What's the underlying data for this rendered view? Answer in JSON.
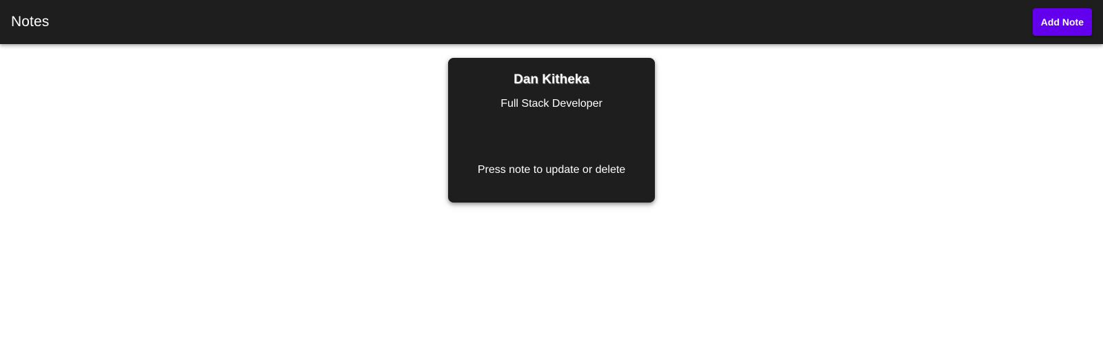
{
  "app_bar": {
    "title": "Notes",
    "add_button_label": "Add Note"
  },
  "notes": [
    {
      "title": "Dan Kitheka",
      "subtitle": "Full Stack Developer",
      "hint": "Press note to update or delete"
    }
  ],
  "colors": {
    "app_bar_bg": "#1e1e1e",
    "accent": "#6200ee",
    "card_bg": "#1e1e1e",
    "page_bg": "#ffffff",
    "text_on_dark": "#ffffff"
  }
}
